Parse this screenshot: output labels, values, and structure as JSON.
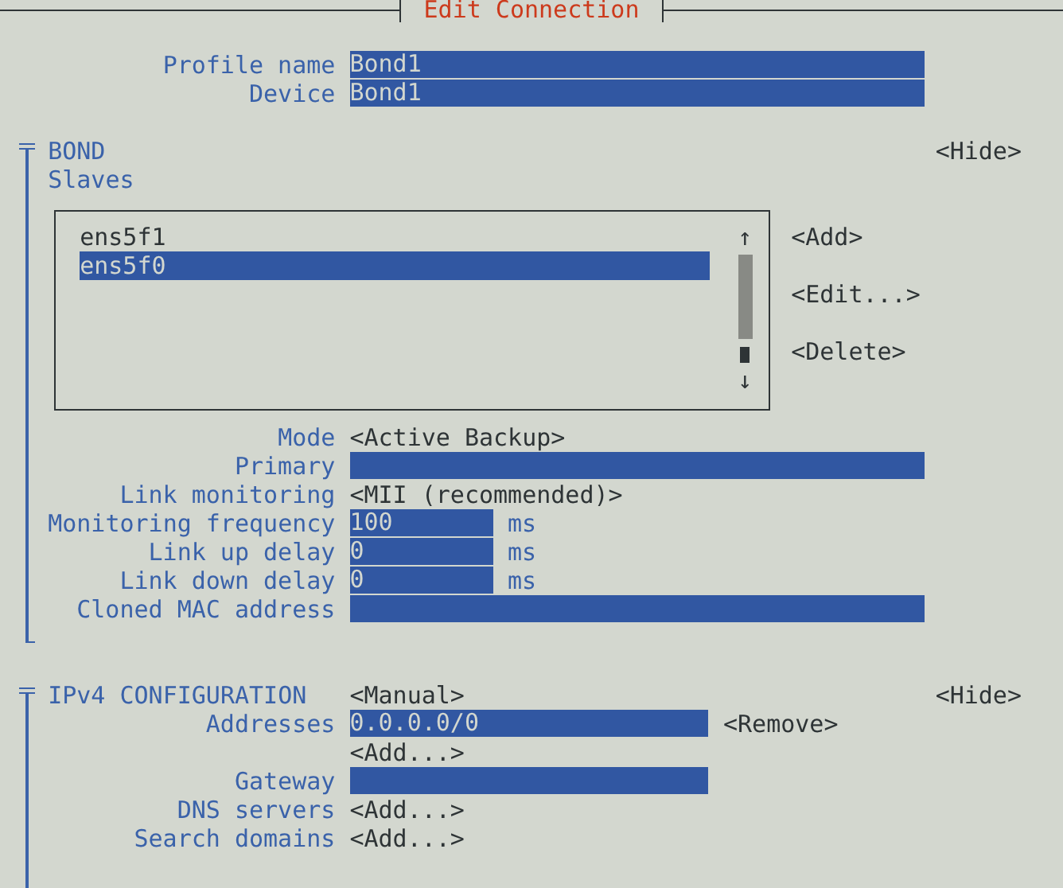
{
  "window": {
    "title": "Edit Connection"
  },
  "profile": [
    {
      "label": "Profile name",
      "kind": "field",
      "value": "Bond1"
    },
    {
      "label": "Device",
      "kind": "field",
      "value": "Bond1"
    }
  ],
  "bond": {
    "title": "BOND",
    "toggle": "<Hide>",
    "slaves_label": "Slaves",
    "slaves": [
      {
        "name": "ens5f1",
        "selected": false
      },
      {
        "name": "ens5f0",
        "selected": true
      }
    ],
    "scroll_up": "↑",
    "scroll_down": "↓",
    "slave_buttons": [
      "<Add>",
      "<Edit...>",
      "<Delete>"
    ],
    "settings": [
      {
        "label": "Mode",
        "kind": "choice",
        "value": "<Active Backup>"
      },
      {
        "label": "Primary",
        "kind": "field"
      },
      {
        "label": "Link monitoring",
        "kind": "choice",
        "value": "<MII (recommended)>"
      },
      {
        "label": "Monitoring frequency",
        "kind": "number",
        "value": "100",
        "unit": "ms"
      },
      {
        "label": "Link up delay",
        "kind": "number",
        "value": "0",
        "unit": "ms"
      },
      {
        "label": "Link down delay",
        "kind": "number",
        "value": "0",
        "unit": "ms"
      },
      {
        "label": "Cloned MAC address",
        "kind": "field"
      }
    ]
  },
  "ipv4": {
    "title": "IPv4 CONFIGURATION",
    "method": "<Manual>",
    "toggle": "<Hide>",
    "settings": [
      {
        "label": "Addresses",
        "kind": "field",
        "value": "0.0.0.0/0",
        "action": "<Remove>"
      },
      {
        "kind": "button",
        "value": "<Add...>"
      },
      {
        "label": "Gateway",
        "kind": "field"
      },
      {
        "label": "DNS servers",
        "kind": "button",
        "value": "<Add...>"
      },
      {
        "label": "Search domains",
        "kind": "button",
        "value": "<Add...>"
      }
    ]
  }
}
